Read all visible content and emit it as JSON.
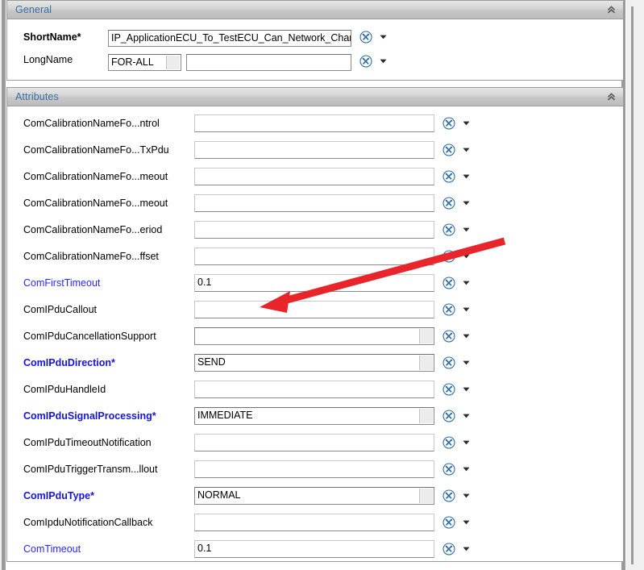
{
  "general": {
    "title": "General",
    "collapse_icon": "chevron-double-up-icon",
    "shortname": {
      "label": "ShortName*",
      "value": "IP_ApplicationECU_To_TestECU_Can_Network_Chan",
      "tool_icon": "configure-tools-icon",
      "caret_icon": "chevron-down-icon"
    },
    "longname": {
      "label": "LongName",
      "scope_value": "FOR-ALL",
      "value": "",
      "tool_icon": "configure-tools-icon",
      "caret_icon": "chevron-down-icon"
    }
  },
  "attributes": {
    "title": "Attributes",
    "collapse_icon": "chevron-double-up-icon",
    "tool_icon": "configure-tools-icon",
    "caret_icon": "chevron-down-icon",
    "rows": [
      {
        "label": "ComCalibrationNameFo...ntrol",
        "value": "",
        "style": "normal",
        "combo": false
      },
      {
        "label": "ComCalibrationNameFo...TxPdu",
        "value": "",
        "style": "normal",
        "combo": false
      },
      {
        "label": "ComCalibrationNameFo...meout",
        "value": "",
        "style": "normal",
        "combo": false
      },
      {
        "label": "ComCalibrationNameFo...meout",
        "value": "",
        "style": "normal",
        "combo": false
      },
      {
        "label": "ComCalibrationNameFo...eriod",
        "value": "",
        "style": "normal",
        "combo": false
      },
      {
        "label": "ComCalibrationNameFo...ffset",
        "value": "",
        "style": "normal",
        "combo": false
      },
      {
        "label": "ComFirstTimeout",
        "value": "0.1",
        "style": "blue",
        "combo": false
      },
      {
        "label": "ComIPduCallout",
        "value": "",
        "style": "normal",
        "combo": false
      },
      {
        "label": "ComIPduCancellationSupport",
        "value": "",
        "style": "normal",
        "combo": true
      },
      {
        "label": "ComIPduDirection*",
        "value": "SEND",
        "style": "boldblue",
        "combo": true
      },
      {
        "label": "ComIPduHandleId",
        "value": "",
        "style": "normal",
        "combo": false
      },
      {
        "label": "ComIPduSignalProcessing*",
        "value": "IMMEDIATE",
        "style": "boldblue",
        "combo": true
      },
      {
        "label": "ComIPduTimeoutNotification",
        "value": "",
        "style": "normal",
        "combo": false
      },
      {
        "label": "ComIPduTriggerTransm...llout",
        "value": "",
        "style": "normal",
        "combo": false
      },
      {
        "label": "ComIPduType*",
        "value": "NORMAL",
        "style": "boldblue",
        "combo": true
      },
      {
        "label": "ComIpduNotificationCallback",
        "value": "",
        "style": "normal",
        "combo": false
      },
      {
        "label": "ComTimeout",
        "value": "0.1",
        "style": "blue",
        "combo": false
      }
    ]
  },
  "annotation": {
    "name": "red-arrow-pointing-to-comipducallout-field",
    "color": "#e8252a"
  },
  "colors": {
    "header_text": "#3a6ea5",
    "label_blue": "#2a2ae6",
    "label_bold_blue": "#1414e0",
    "tool_icon_blue": "#2e6da4",
    "annotation_red": "#e8252a"
  }
}
